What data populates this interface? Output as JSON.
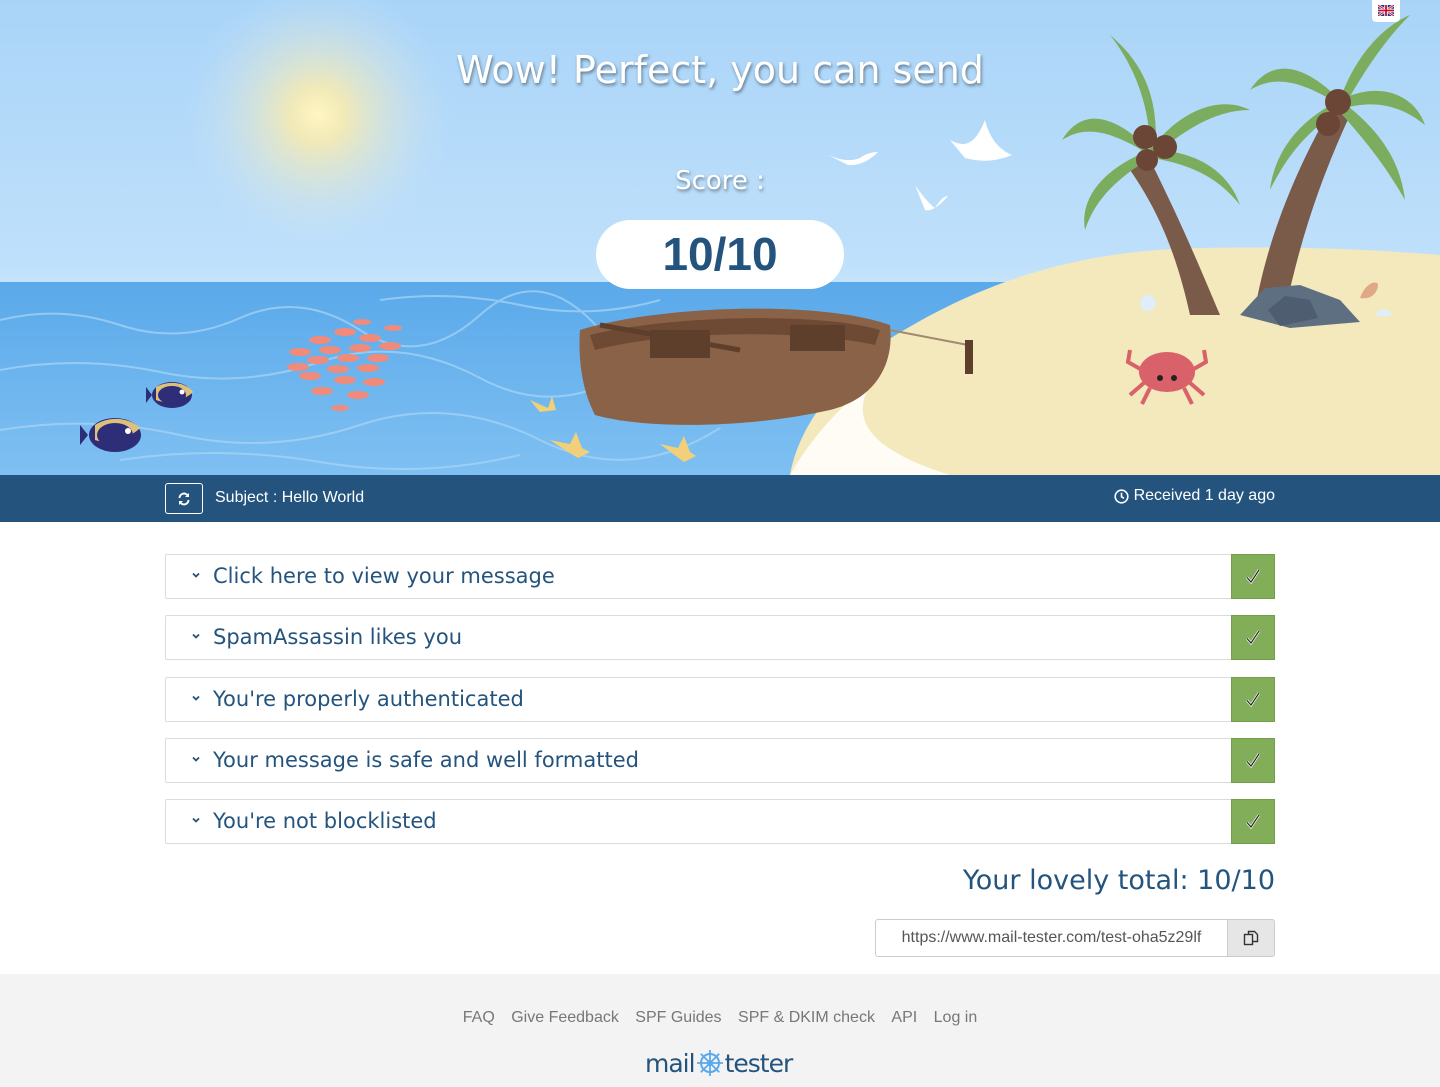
{
  "hero": {
    "title": "Wow! Perfect, you can send",
    "score_label": "Score :",
    "score": "10/10",
    "language_flag": "uk-flag-icon"
  },
  "subject_bar": {
    "refresh_icon": "refresh-icon",
    "subject": "Subject : Hello World",
    "received": "Received 1 day ago"
  },
  "panels": [
    {
      "title": "Click here to view your message",
      "status": "pass"
    },
    {
      "title": "SpamAssassin likes you",
      "status": "pass"
    },
    {
      "title": "You're properly authenticated",
      "status": "pass"
    },
    {
      "title": "Your message is safe and well formatted",
      "status": "pass"
    },
    {
      "title": "You're not blocklisted",
      "status": "pass"
    }
  ],
  "total": "Your lovely total: 10/10",
  "share": {
    "url": "https://www.mail-tester.com/test-oha5z29lf",
    "copy_icon": "copy-icon"
  },
  "footer": {
    "links": [
      "FAQ",
      "Give Feedback",
      "SPF Guides",
      "SPF & DKIM check",
      "API",
      "Log in"
    ],
    "logo_left": "mail",
    "logo_right": "tester"
  },
  "colors": {
    "brand_blue": "#24547e",
    "pass_green": "#83ae59",
    "footer_bg": "#f3f3f3"
  }
}
